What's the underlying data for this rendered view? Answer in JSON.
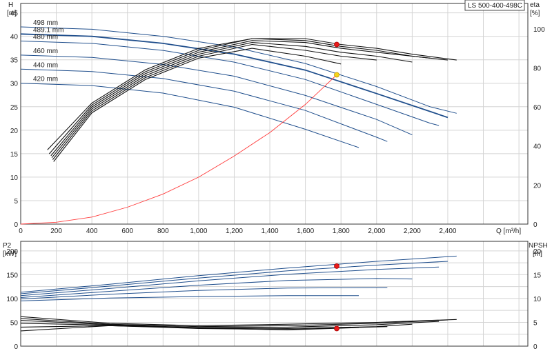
{
  "title_box": "LS 500-400-498C",
  "colors": {
    "curve_blue": "#1f4e8c",
    "curve_black": "#111111",
    "system_red": "#ff3b3b",
    "duty_yellow": "#f6d31a",
    "duty_red": "#e81b1b",
    "grid": "#d4d4d4"
  },
  "chart_data": [
    {
      "type": "line",
      "name": "top",
      "xlabel": "Q [m³/h]",
      "xlim": [
        0,
        2850
      ],
      "xticks": [
        0,
        200,
        400,
        600,
        800,
        1000,
        1200,
        1400,
        1600,
        1800,
        2000,
        2200,
        2400
      ],
      "xtick_labels": [
        "0",
        "200",
        "400",
        "600",
        "800",
        "1,000",
        "1,200",
        "1,400",
        "1,600",
        "1,800",
        "2,000",
        "2,200",
        "2,400"
      ],
      "ylabel_left": [
        "H",
        "[m]"
      ],
      "ylim_left": [
        0,
        47
      ],
      "yticks_left": [
        0,
        5,
        10,
        15,
        20,
        25,
        30,
        35,
        40,
        45
      ],
      "ylabel_right": [
        "eta",
        "[%]"
      ],
      "ylim_right": [
        0,
        113
      ],
      "yticks_right": [
        0,
        20,
        40,
        60,
        80,
        100
      ],
      "grid": true,
      "head_curves": [
        {
          "label": "498 mm",
          "x": [
            0,
            400,
            800,
            1200,
            1600,
            2000,
            2300,
            2450
          ],
          "y": [
            42.0,
            41.5,
            40.0,
            37.7,
            34.2,
            29.3,
            25.0,
            23.6
          ]
        },
        {
          "label": "489.1 mm",
          "x": [
            0,
            400,
            800,
            1200,
            1600,
            2000,
            2300,
            2400
          ],
          "y": [
            40.5,
            40.0,
            38.5,
            36.2,
            32.8,
            27.8,
            24.0,
            22.7
          ]
        },
        {
          "label": "480 mm",
          "x": [
            0,
            400,
            800,
            1200,
            1600,
            2000,
            2300,
            2350
          ],
          "y": [
            39.0,
            38.5,
            37.0,
            34.5,
            30.8,
            25.5,
            21.5,
            21.0
          ]
        },
        {
          "label": "460 mm",
          "x": [
            0,
            400,
            800,
            1200,
            1600,
            2000,
            2200
          ],
          "y": [
            36.0,
            35.5,
            34.0,
            31.5,
            27.4,
            22.3,
            19.0
          ]
        },
        {
          "label": "440 mm",
          "x": [
            0,
            400,
            800,
            1200,
            1600,
            2000,
            2060
          ],
          "y": [
            33.0,
            32.5,
            31.0,
            28.3,
            24.2,
            18.5,
            17.6
          ]
        },
        {
          "label": "420 mm",
          "x": [
            0,
            400,
            800,
            1200,
            1600,
            1900
          ],
          "y": [
            30.0,
            29.5,
            27.9,
            24.9,
            20.2,
            16.3
          ]
        }
      ],
      "eta_curves": [
        {
          "x": [
            150,
            400,
            700,
            1000,
            1300,
            1600,
            1800,
            2000,
            2200,
            2450
          ],
          "y": [
            38,
            62,
            79,
            90,
            95,
            95,
            92,
            90,
            87,
            84
          ]
        },
        {
          "x": [
            160,
            400,
            700,
            1000,
            1300,
            1600,
            1800,
            2000,
            2200,
            2400
          ],
          "y": [
            36,
            61,
            78,
            89,
            95,
            94,
            91,
            89,
            86,
            84
          ]
        },
        {
          "x": [
            170,
            400,
            700,
            1000,
            1300,
            1600,
            1800,
            2000,
            2300
          ],
          "y": [
            35,
            60,
            77,
            88,
            94,
            93,
            90,
            88,
            85
          ]
        },
        {
          "x": [
            175,
            400,
            700,
            1000,
            1300,
            1600,
            1800,
            2000,
            2200
          ],
          "y": [
            34,
            59,
            76,
            87,
            93,
            91,
            88,
            86,
            83
          ]
        },
        {
          "x": [
            180,
            400,
            700,
            1000,
            1300,
            1600,
            1800,
            2000
          ],
          "y": [
            33,
            58,
            75,
            86,
            92,
            89,
            86,
            84
          ]
        },
        {
          "x": [
            185,
            400,
            700,
            1000,
            1300,
            1600,
            1800
          ],
          "y": [
            32,
            57,
            74,
            85,
            90,
            86,
            82
          ]
        }
      ],
      "system_curve": {
        "x": [
          0,
          200,
          400,
          600,
          800,
          1000,
          1200,
          1400,
          1600,
          1776
        ],
        "y": [
          0,
          0.4,
          1.5,
          3.6,
          6.4,
          10.0,
          14.5,
          19.5,
          25.5,
          31.8
        ]
      },
      "duty_points": [
        {
          "x": 1776,
          "y": 31.8,
          "axis": "left",
          "color": "yellow"
        },
        {
          "x": 1776,
          "y": 92,
          "axis": "right",
          "color": "red"
        }
      ]
    },
    {
      "type": "line",
      "name": "bottom",
      "xlim": [
        0,
        2850
      ],
      "ylabel_left": [
        "P2",
        "[kW]"
      ],
      "ylim_left": [
        0,
        220
      ],
      "yticks_left": [
        0,
        50,
        100,
        150,
        200
      ],
      "ylabel_right": [
        "NPSH",
        "[m]"
      ],
      "ylim_right": [
        0,
        22
      ],
      "yticks_right": [
        0,
        5,
        10,
        15,
        20
      ],
      "grid": true,
      "power_curves": [
        {
          "x": [
            0,
            500,
            1000,
            1500,
            2000,
            2450
          ],
          "y": [
            113,
            130,
            148,
            164,
            178,
            189
          ]
        },
        {
          "x": [
            0,
            500,
            1000,
            1500,
            2000,
            2400
          ],
          "y": [
            110,
            126,
            143,
            158,
            170,
            178
          ]
        },
        {
          "x": [
            0,
            500,
            1000,
            1500,
            2000,
            2350
          ],
          "y": [
            106,
            121,
            137,
            151,
            161,
            166
          ]
        },
        {
          "x": [
            0,
            500,
            1000,
            1500,
            2000,
            2200
          ],
          "y": [
            102,
            115,
            128,
            138,
            142,
            141
          ]
        },
        {
          "x": [
            0,
            500,
            1000,
            1500,
            2060
          ],
          "y": [
            99,
            109,
            117,
            122,
            123
          ]
        },
        {
          "x": [
            0,
            500,
            1000,
            1500,
            1900
          ],
          "y": [
            95,
            101,
            104,
            106,
            106
          ]
        }
      ],
      "npsh_curves": [
        {
          "x": [
            0,
            500,
            1000,
            1500,
            2000,
            2450
          ],
          "y": [
            6.2,
            4.8,
            4.3,
            4.6,
            5.0,
            5.6
          ]
        },
        {
          "x": [
            0,
            500,
            1000,
            1500,
            2000,
            2400
          ],
          "y": [
            5.8,
            4.6,
            4.1,
            4.3,
            4.8,
            5.5
          ]
        },
        {
          "x": [
            0,
            500,
            1000,
            1500,
            2000,
            2350
          ],
          "y": [
            5.4,
            4.5,
            3.9,
            4.0,
            4.5,
            5.2
          ]
        },
        {
          "x": [
            0,
            500,
            1000,
            1500,
            2000,
            2200
          ],
          "y": [
            4.8,
            4.4,
            3.8,
            3.7,
            4.1,
            4.6
          ]
        },
        {
          "x": [
            0,
            500,
            1000,
            1500,
            2060
          ],
          "y": [
            4.0,
            4.3,
            3.7,
            3.5,
            4.1
          ]
        },
        {
          "x": [
            0,
            500,
            1000,
            1500,
            1900
          ],
          "y": [
            3.2,
            4.3,
            3.8,
            3.4,
            3.9
          ]
        }
      ],
      "duty_points": [
        {
          "x": 1776,
          "y": 168,
          "axis": "left",
          "color": "red"
        },
        {
          "x": 1776,
          "y": 3.7,
          "axis": "right",
          "color": "red"
        }
      ]
    }
  ]
}
